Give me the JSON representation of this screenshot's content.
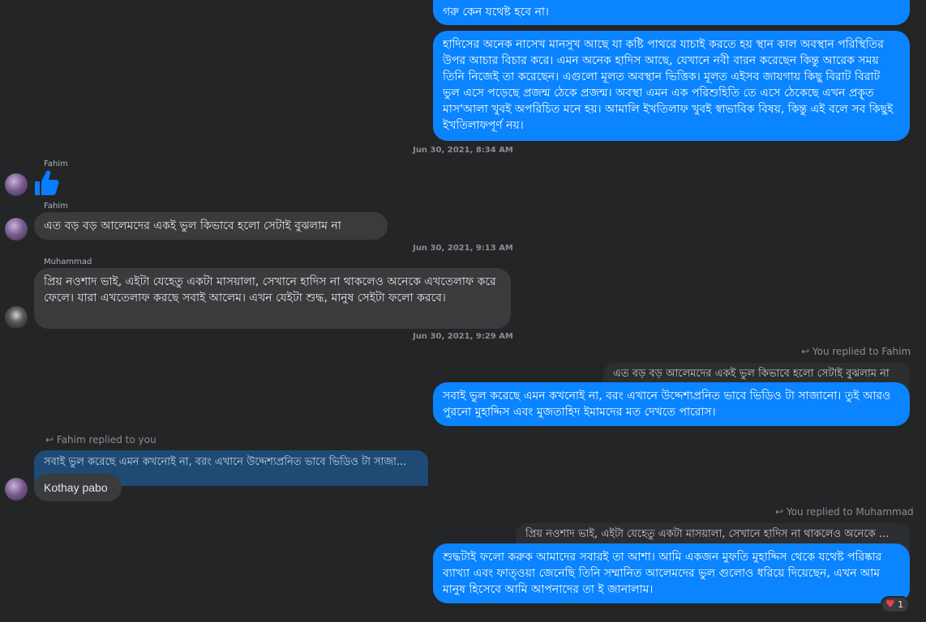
{
  "messages": {
    "m1_text": "গরু কেন যথেষ্ট হবে না।",
    "m2_text": "হাদিসের অনেক নাসেখ মানসুখ আছে যা কষ্টি পাথরে যাচাই করতে হয় স্থান কাল অবস্থান পরিস্থিতির উপর আচার বিচার করে। এমন অনেক হাদিস আছে, যেখানে নবী বারন করেছেন কিন্তু আরেক সময় তিনি নিজেই তা করেছেন। এগুলো মূলত অবস্থান ভিত্তিক। মূলত এইসব জায়গায় কিছু বিরাট বিরাট ভুল এসে পড়েছে প্রজন্ম ঠেকে প্রজন্ম। অবস্থা এমন এক পরিশুহিতি তে এসে ঠেকেছে এখন প্রকৃ্ত মাস'আলা খুবই অপরিচিত মনে হয়। আমালি ইখতিলাফ খুবই স্বাভাবিক বিষয়, কিন্তু এই বলে সব কিছুই ইখতিলাফপূর্ণ নয়।",
    "ts1": "Jun 30, 2021, 8:34 AM",
    "sender_fahim_1": "Fahim",
    "sender_fahim_2": "Fahim",
    "m3_text": "এত বড় বড় আলেমদের একই ভুল কিভাবে হলো সেটাই বুঝলাম না",
    "ts2": "Jun 30, 2021, 9:13 AM",
    "sender_muhammad": "Muhammad",
    "m4_text": "প্রিয় নওশাদ ভাই, এইটা যেহেতু একটা মাসয়ালা, সেখানে হাদিস না থাকলেও অনেকে এখতেলাফ করে ফেলে। যারা এখতেলাফ করছে সবাই আলেম। এখন যেইটা শুদ্ধ, মানুষ সেইটা ফলো করবে।",
    "ts3": "Jun 30, 2021, 9:29 AM",
    "reply_note_1": "You replied to Fahim",
    "quote_1": "এত বড় বড় আলেমদের একই ভুল কিভাবে হলো সেটাই বুঝলাম না",
    "m5_text": "সবাই ভুল করেছে এমন কখনোই না, বরং এখানে উদ্দেশ্যপ্রনিত ভাবে ভিডিও টা সাজানো। তুই আরও পুরনো মুহাদ্দিস এবং মুজতাহিদ ইমামদের মত দেখতে পারোস।",
    "reply_note_2": "Fahim replied to you",
    "quote_2": "সবাই ভুল করেছে এমন কখনোই না, বরং এখানে উদ্দেশ্যপ্রনিত ভাবে ভিডিও টা সাজা...",
    "m6_text": "Kothay pabo",
    "reply_note_3": "You replied to Muhammad",
    "quote_3": "প্রিয় নওশাদ ভাই, এইটা যেহেতু একটা মাসয়ালা, সেখানে হাদিস না থাকলেও অনেকে ...",
    "m7_text": "শুদ্ধটাই ফলো করুক আমাদের সবারই তা আশা। আমি একজন মুফতি মুহাদ্দিস থেকে যথেষ্ট পরিষ্কার ব্যাখ্যা এবং ফাত্ওয়া জেনেছি তিনি সম্মানিত আলেমদের ভুল গুলোও ধরিয়ে দিয়েছেন, এখন আম মানুষ হিসেবে আমি আপনাদের তা ই জানালাম।",
    "reaction_count": "1"
  },
  "icons": {
    "like": "thumbs-up-icon",
    "reply": "reply-arrow-icon",
    "reaction": "heart-icon"
  },
  "colors": {
    "outgoing_bubble": "#0a84ff",
    "incoming_bubble": "#3a3b3c",
    "background": "#242526",
    "like_icon": "#0a7cff",
    "heart": "#f33e58"
  }
}
